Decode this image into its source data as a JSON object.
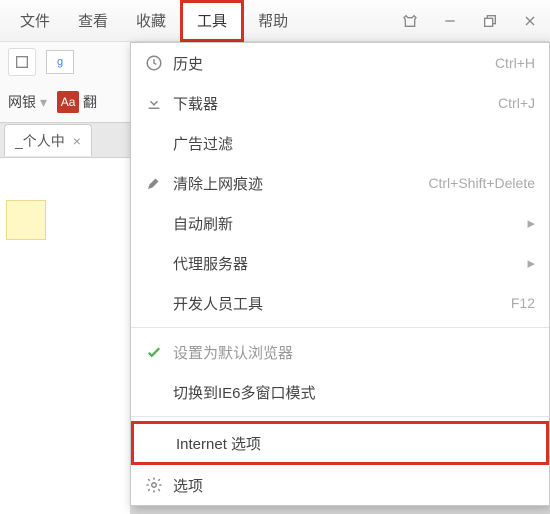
{
  "menubar": {
    "items": [
      {
        "label": "文件"
      },
      {
        "label": "查看"
      },
      {
        "label": "收藏"
      },
      {
        "label": "工具"
      },
      {
        "label": "帮助"
      }
    ],
    "selected_index": 3
  },
  "toolbar": {
    "bookmark1": "网银",
    "bookmark2": "翻"
  },
  "tab": {
    "title": "_个人中",
    "close": "×"
  },
  "dropdown": {
    "items": [
      {
        "icon": "clock",
        "label": "历史",
        "shortcut": "Ctrl+H"
      },
      {
        "icon": "download",
        "label": "下载器",
        "shortcut": "Ctrl+J"
      },
      {
        "icon": "",
        "label": "广告过滤",
        "shortcut": ""
      },
      {
        "icon": "brush",
        "label": "清除上网痕迹",
        "shortcut": "Ctrl+Shift+Delete"
      },
      {
        "icon": "",
        "label": "自动刷新",
        "shortcut": "",
        "submenu": true
      },
      {
        "icon": "",
        "label": "代理服务器",
        "shortcut": "",
        "submenu": true
      },
      {
        "icon": "",
        "label": "开发人员工具",
        "shortcut": "F12"
      },
      {
        "sep": true
      },
      {
        "icon": "check",
        "label": "设置为默认浏览器",
        "shortcut": "",
        "gray": true
      },
      {
        "icon": "",
        "label": "切换到IE6多窗口模式",
        "shortcut": ""
      },
      {
        "sep": true
      },
      {
        "icon": "",
        "label": "Internet 选项",
        "shortcut": "",
        "highlight": true
      },
      {
        "icon": "gear",
        "label": "选项",
        "shortcut": ""
      }
    ]
  }
}
